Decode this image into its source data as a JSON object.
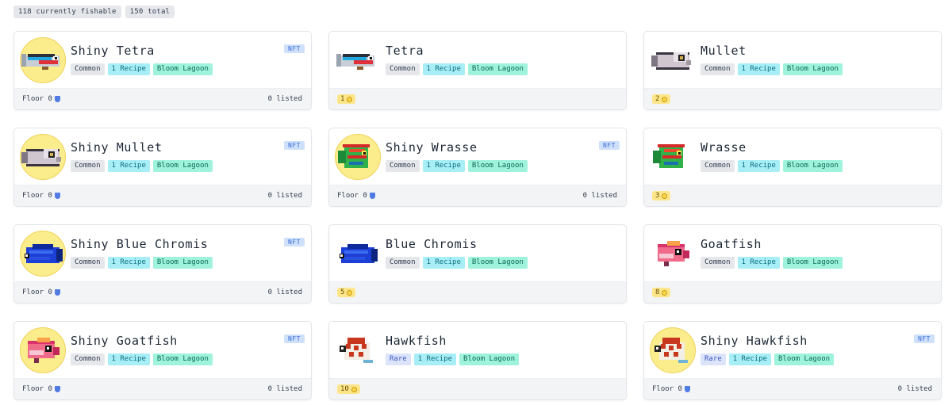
{
  "counts": {
    "fishable": "118 currently fishable",
    "total": "150 total"
  },
  "floor_label": "Floor 0",
  "listed_label": "0 listed",
  "nft_label": "NFT",
  "cards": [
    {
      "name": "Shiny Tetra",
      "shiny": true,
      "rarity": "Common",
      "recipe": "1 Recipe",
      "location": "Bloom Lagoon",
      "price": "",
      "icon": "tetra-fish-icon"
    },
    {
      "name": "Tetra",
      "shiny": false,
      "rarity": "Common",
      "recipe": "1 Recipe",
      "location": "Bloom Lagoon",
      "price": "1",
      "icon": "tetra-fish-icon"
    },
    {
      "name": "Mullet",
      "shiny": false,
      "rarity": "Common",
      "recipe": "1 Recipe",
      "location": "Bloom Lagoon",
      "price": "2",
      "icon": "mullet-fish-icon"
    },
    {
      "name": "Shiny Mullet",
      "shiny": true,
      "rarity": "Common",
      "recipe": "1 Recipe",
      "location": "Bloom Lagoon",
      "price": "",
      "icon": "mullet-fish-icon"
    },
    {
      "name": "Shiny Wrasse",
      "shiny": true,
      "rarity": "Common",
      "recipe": "1 Recipe",
      "location": "Bloom Lagoon",
      "price": "",
      "icon": "wrasse-fish-icon"
    },
    {
      "name": "Wrasse",
      "shiny": false,
      "rarity": "Common",
      "recipe": "1 Recipe",
      "location": "Bloom Lagoon",
      "price": "3",
      "icon": "wrasse-fish-icon"
    },
    {
      "name": "Shiny Blue Chromis",
      "shiny": true,
      "rarity": "Common",
      "recipe": "1 Recipe",
      "location": "Bloom Lagoon",
      "price": "",
      "icon": "blue-chromis-fish-icon"
    },
    {
      "name": "Blue Chromis",
      "shiny": false,
      "rarity": "Common",
      "recipe": "1 Recipe",
      "location": "Bloom Lagoon",
      "price": "5",
      "icon": "blue-chromis-fish-icon"
    },
    {
      "name": "Goatfish",
      "shiny": false,
      "rarity": "Common",
      "recipe": "1 Recipe",
      "location": "Bloom Lagoon",
      "price": "8",
      "icon": "goatfish-fish-icon"
    },
    {
      "name": "Shiny Goatfish",
      "shiny": true,
      "rarity": "Common",
      "recipe": "1 Recipe",
      "location": "Bloom Lagoon",
      "price": "",
      "icon": "goatfish-fish-icon"
    },
    {
      "name": "Hawkfish",
      "shiny": false,
      "rarity": "Rare",
      "recipe": "1 Recipe",
      "location": "Bloom Lagoon",
      "price": "10",
      "icon": "hawkfish-fish-icon"
    },
    {
      "name": "Shiny Hawkfish",
      "shiny": true,
      "rarity": "Rare",
      "recipe": "1 Recipe",
      "location": "Bloom Lagoon",
      "price": "",
      "icon": "hawkfish-fish-icon"
    }
  ],
  "colors": {
    "shiny_ring": "#fbec8c",
    "recipe_tag": "#a7eef6",
    "location_tag": "#9ff2dc",
    "nft_badge": "#cfe0fb",
    "price_badge": "#fde68a"
  }
}
